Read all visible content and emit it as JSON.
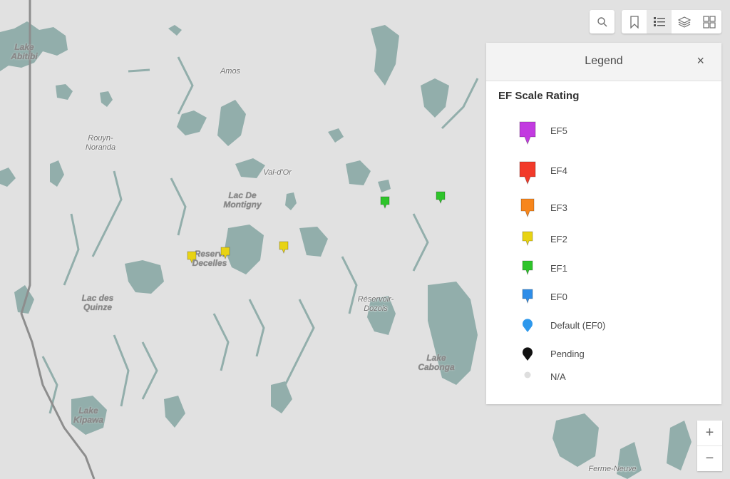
{
  "map": {
    "colors": {
      "land": "#e1e1e1",
      "water": "#92aeab",
      "boundary": "#8d8d8d"
    },
    "place_labels": [
      {
        "text": "Lake\nAbitibi",
        "style": "big"
      },
      {
        "text": "Amos",
        "style": "normal"
      },
      {
        "text": "Rouyn-\nNoranda",
        "style": "normal"
      },
      {
        "text": "Val-d'Or",
        "style": "normal"
      },
      {
        "text": "Lac De\nMontigny",
        "style": "big"
      },
      {
        "text": "Reserv.\nDecelles",
        "style": "big"
      },
      {
        "text": "Lac des\nQuinze",
        "style": "big"
      },
      {
        "text": "Réservoir-\nDozois",
        "style": "normal"
      },
      {
        "text": "Lake\nCabonga",
        "style": "big"
      },
      {
        "text": "Lake\nKipawa",
        "style": "big"
      },
      {
        "text": "Ferme-Neuve",
        "style": "normal"
      }
    ],
    "markers": [
      {
        "rating": "EF2"
      },
      {
        "rating": "EF2"
      },
      {
        "rating": "EF2"
      },
      {
        "rating": "EF1"
      },
      {
        "rating": "EF1"
      }
    ]
  },
  "toolbar": {
    "search_icon": "search-icon",
    "buttons": [
      {
        "name": "bookmarks",
        "icon": "bookmark-icon",
        "active": false
      },
      {
        "name": "legend",
        "icon": "legend-list-icon",
        "active": true
      },
      {
        "name": "layers",
        "icon": "layers-icon",
        "active": false
      },
      {
        "name": "basemap-gallery",
        "icon": "basemap-gallery-icon",
        "active": false
      }
    ]
  },
  "legend": {
    "title": "Legend",
    "close_label": "×",
    "section_title": "EF Scale Rating",
    "items": [
      {
        "label": "EF5",
        "color": "#c23be0",
        "shape": "pin-large"
      },
      {
        "label": "EF4",
        "color": "#f23a2a",
        "shape": "pin-large"
      },
      {
        "label": "EF3",
        "color": "#f7861c",
        "shape": "pin-medium"
      },
      {
        "label": "EF2",
        "color": "#e8d313",
        "shape": "pin-small"
      },
      {
        "label": "EF1",
        "color": "#2ec42a",
        "shape": "pin-small"
      },
      {
        "label": "EF0",
        "color": "#2e8de8",
        "shape": "pin-small"
      },
      {
        "label": "Default (EF0)",
        "color": "#2e98ec",
        "shape": "teardrop"
      },
      {
        "label": "Pending",
        "color": "#111111",
        "shape": "teardrop"
      },
      {
        "label": "N/A",
        "color": "#dedede",
        "shape": "dot"
      }
    ]
  },
  "zoom_controls": {
    "zoom_in": "+",
    "zoom_out": "−"
  }
}
